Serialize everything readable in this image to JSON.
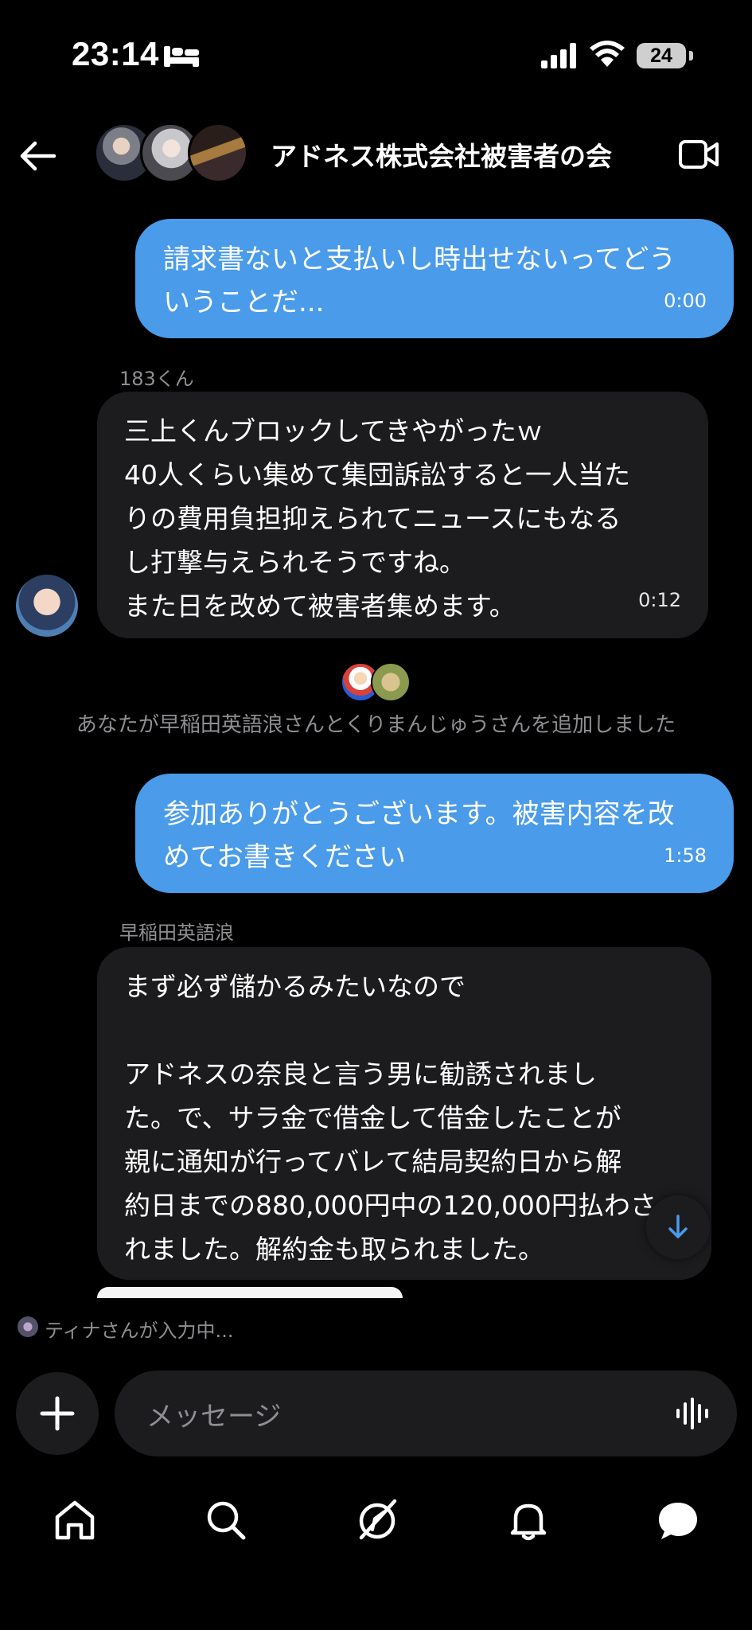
{
  "status_bar": {
    "time": "23:14",
    "battery": "24",
    "icons": [
      "bed-icon",
      "signal-icon",
      "wifi-icon",
      "battery-icon"
    ]
  },
  "header": {
    "title": "アドネス株式会社被害者の会",
    "icons": [
      "back-arrow-icon",
      "video-call-icon"
    ]
  },
  "messages": [
    {
      "direction": "outgoing",
      "lines": [
        "請求書ないと支払いし時出せないってどう",
        "いうことだ..."
      ],
      "time": "0:00"
    },
    {
      "direction": "incoming",
      "sender": "183くん",
      "lines": [
        "三上くんブロックしてきやがったｗ",
        "40人くらい集めて集団訴訟すると一人当た",
        "りの費用負担抑えられてニュースにもなる",
        "し打撃与えられそうですね。",
        "また日を改めて被害者集めます。"
      ],
      "time": "0:12"
    },
    {
      "direction": "outgoing",
      "lines": [
        "参加ありがとうございます。被害内容を改",
        "めてお書きください"
      ],
      "time": "1:58"
    },
    {
      "direction": "incoming",
      "sender": "早稲田英語浪",
      "lines": [
        "まず必ず儲かるみたいなので",
        "",
        "アドネスの奈良と言う男に勧誘されまし",
        "た。で、サラ金で借金して借金したことが",
        "親に通知が行ってバレて結局契約日から解",
        "約日までの880,000円中の120,000円払わさ",
        "れました。解約金も取られました。"
      ]
    }
  ],
  "system_note": "あなたが早稲田英語浪さんとくりまんじゅうさんを追加しました",
  "typing_indicator": "ティナさんが入力中...",
  "composer": {
    "placeholder": "メッセージ"
  },
  "colors": {
    "outgoing_bubble": "#4a9bea",
    "incoming_bubble": "#1c1c1e",
    "background": "#000000",
    "secondary_text": "#8e8e93"
  },
  "tab_bar": {
    "tabs": [
      "home-icon",
      "search-icon",
      "explore-icon",
      "notifications-icon",
      "messages-icon"
    ],
    "active": "messages-icon"
  }
}
